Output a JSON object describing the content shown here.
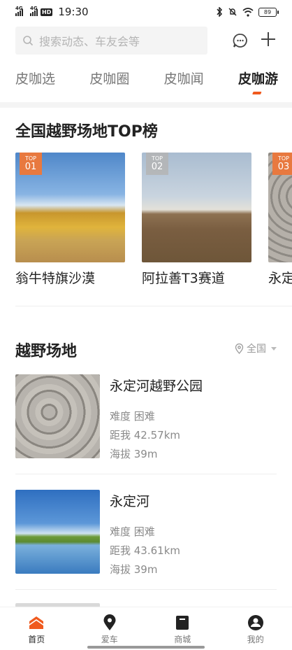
{
  "status_bar": {
    "net1": "4G",
    "net2": "4G",
    "hd": "HD",
    "time": "19:30",
    "battery": "89"
  },
  "search": {
    "placeholder": "搜索动态、车友会等"
  },
  "tabs": [
    {
      "label": "皮咖选"
    },
    {
      "label": "皮咖圈"
    },
    {
      "label": "皮咖闻"
    },
    {
      "label": "皮咖游",
      "active": true
    }
  ],
  "top_section": {
    "title": "全国越野场地TOP榜",
    "items": [
      {
        "badge_top": "TOP",
        "badge_num": "01",
        "name": "翁牛特旗沙漠"
      },
      {
        "badge_top": "TOP",
        "badge_num": "02",
        "name": "阿拉善T3赛道"
      },
      {
        "badge_top": "TOP",
        "badge_num": "03",
        "name": "永定河越野公园"
      }
    ]
  },
  "sites_section": {
    "title": "越野场地",
    "filter": "全国",
    "items": [
      {
        "name": "永定河越野公园",
        "difficulty": "难度 困难",
        "distance": "距我 42.57km",
        "altitude": "海拔 39m"
      },
      {
        "name": "永定河",
        "difficulty": "难度 困难",
        "distance": "距我 43.61km",
        "altitude": "海拔 39m"
      }
    ]
  },
  "bottom_nav": [
    {
      "label": "首页",
      "icon": "home-icon",
      "active": true
    },
    {
      "label": "爱车",
      "icon": "location-pin-icon"
    },
    {
      "label": "商城",
      "icon": "shop-icon"
    },
    {
      "label": "我的",
      "icon": "profile-icon"
    }
  ],
  "colors": {
    "accent": "#f05a1e"
  }
}
